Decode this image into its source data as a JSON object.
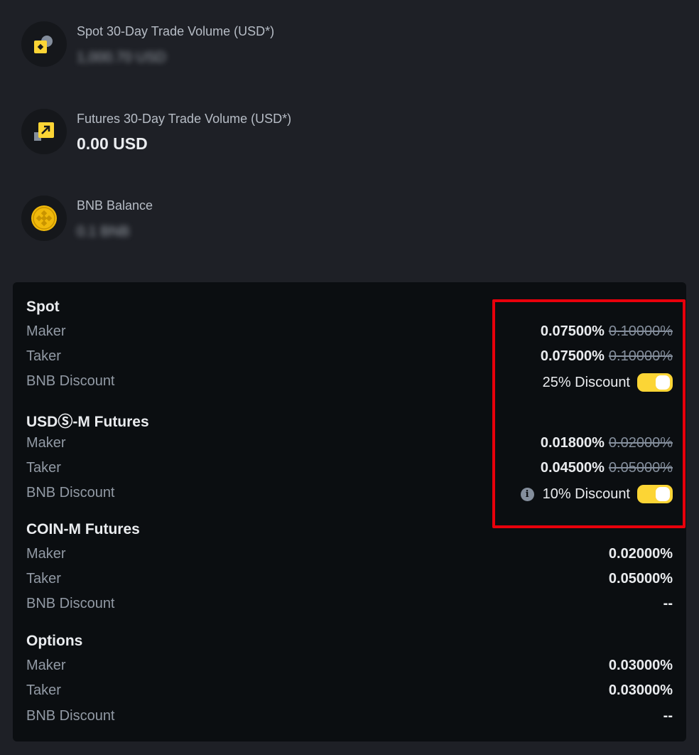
{
  "stats": [
    {
      "icon": "spot-volume-icon",
      "label": "Spot 30-Day Trade Volume (USD*)",
      "value": "1,000.70 USD",
      "blurred": true
    },
    {
      "icon": "futures-volume-icon",
      "label": "Futures 30-Day Trade Volume (USD*)",
      "value": "0.00 USD",
      "blurred": false
    },
    {
      "icon": "bnb-icon",
      "label": "BNB Balance",
      "value": "0.1 BNB",
      "blurred": true
    }
  ],
  "sections": {
    "spot": {
      "title": "Spot",
      "maker_label": "Maker",
      "maker_value": "0.07500%",
      "maker_old": "0.10000%",
      "taker_label": "Taker",
      "taker_value": "0.07500%",
      "taker_old": "0.10000%",
      "bnb_label": "BNB Discount",
      "bnb_value": "25% Discount",
      "bnb_enabled": true
    },
    "usdm": {
      "title": "USDⓈ-M Futures",
      "maker_label": "Maker",
      "maker_value": "0.01800%",
      "maker_old": "0.02000%",
      "taker_label": "Taker",
      "taker_value": "0.04500%",
      "taker_old": "0.05000%",
      "bnb_label": "BNB Discount",
      "bnb_value": "10% Discount",
      "bnb_enabled": true
    },
    "coinm": {
      "title": "COIN-M Futures",
      "maker_label": "Maker",
      "maker_value": "0.02000%",
      "taker_label": "Taker",
      "taker_value": "0.05000%",
      "bnb_label": "BNB Discount",
      "bnb_value": "--"
    },
    "options": {
      "title": "Options",
      "maker_label": "Maker",
      "maker_value": "0.03000%",
      "taker_label": "Taker",
      "taker_value": "0.03000%",
      "bnb_label": "BNB Discount",
      "bnb_value": "--"
    }
  },
  "colors": {
    "accent": "#fcd535",
    "highlight": "#e8000b",
    "background": "#1e2026",
    "panel": "#0b0e11"
  }
}
